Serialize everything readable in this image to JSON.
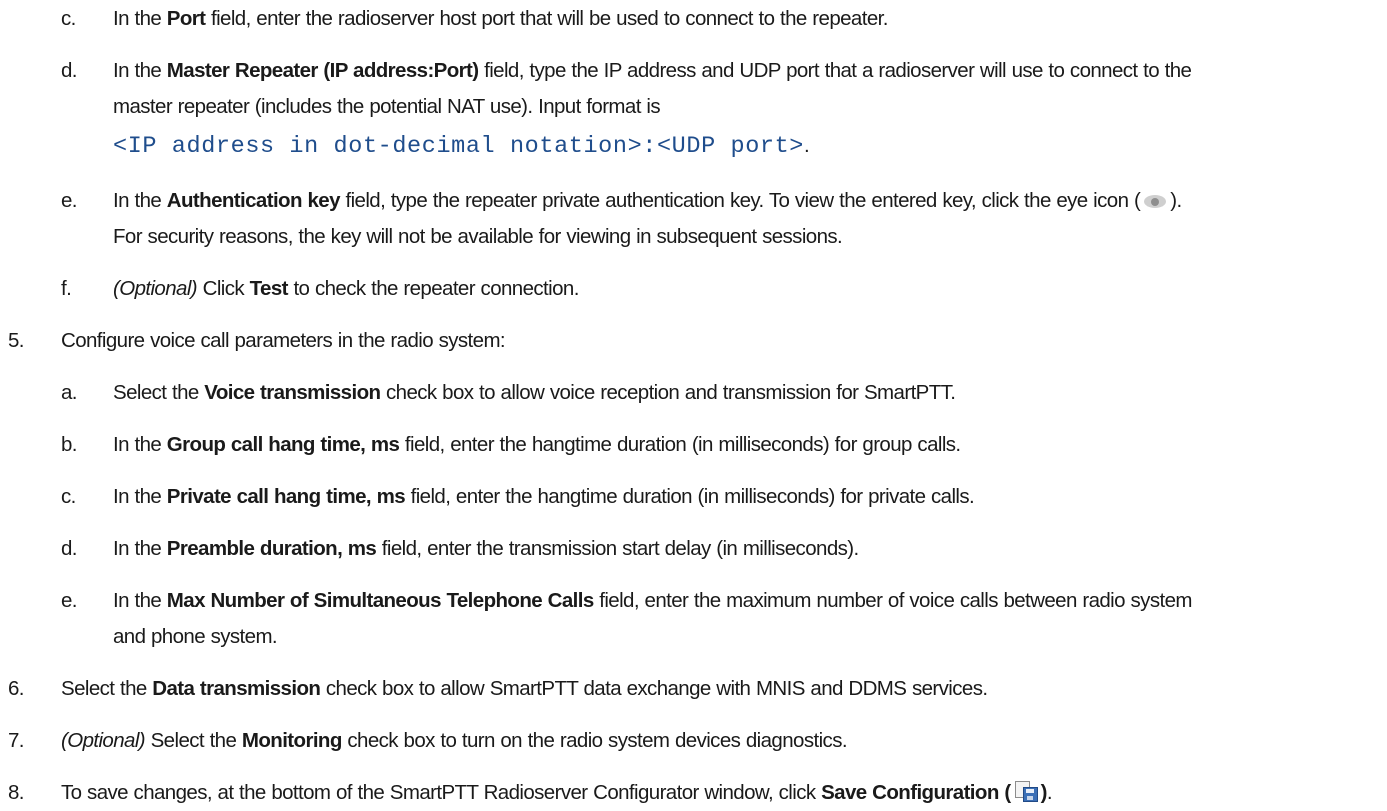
{
  "c_port": {
    "marker": "c.",
    "pre": "In the ",
    "field": "Port",
    "post": " field, enter the radioserver host port that will be used to connect to the repeater."
  },
  "d_master": {
    "marker": "d.",
    "pre": "In the ",
    "field": "Master Repeater (IP address:Port)",
    "post": " field, type the IP address and UDP port that a radioserver will use to connect to the",
    "line2": "master repeater (includes the potential NAT use). Input format is",
    "code": "<IP address in dot-decimal notation>:<UDP port>",
    "code_end": "."
  },
  "e_auth": {
    "marker": "e.",
    "pre": "In the ",
    "field": "Authentication key",
    "post": " field, type the repeater private authentication key. To view the entered key, click the eye icon (",
    "icon": "eye-icon",
    "post2": ").",
    "line2": "For security reasons, the key will not be available for viewing in subsequent sessions."
  },
  "f_test": {
    "marker": "f.",
    "optional": "(Optional)",
    "pre": " Click ",
    "button": "Test",
    "post": " to check the repeater connection."
  },
  "step5": {
    "marker": "5.",
    "text": "Configure voice call parameters in the radio system:"
  },
  "s5a": {
    "marker": "a.",
    "pre": "Select the ",
    "field": "Voice transmission",
    "post": " check box to allow voice reception and transmission for SmartPTT."
  },
  "s5b": {
    "marker": "b.",
    "pre": "In the ",
    "field": "Group call hang time, ms",
    "post": " field, enter the hangtime duration (in milliseconds) for group calls."
  },
  "s5c": {
    "marker": "c.",
    "pre": "In the ",
    "field": "Private call hang time, ms",
    "post": " field, enter the hangtime duration (in milliseconds) for private calls."
  },
  "s5d": {
    "marker": "d.",
    "pre": "In the ",
    "field": "Preamble duration, ms",
    "post": " field, enter the transmission start delay (in milliseconds)."
  },
  "s5e": {
    "marker": "e.",
    "pre": "In the ",
    "field": "Max Number of Simultaneous Telephone Calls",
    "post": " field, enter the maximum number of voice calls between radio system",
    "line2": "and phone system."
  },
  "step6": {
    "marker": "6.",
    "pre": "Select the ",
    "field": "Data transmission",
    "post": " check box to allow SmartPTT data exchange with MNIS and DDMS services."
  },
  "step7": {
    "marker": "7.",
    "optional": "(Optional)",
    "pre": " Select the ",
    "field": "Monitoring",
    "post": " check box to turn on the radio system devices diagnostics."
  },
  "step8": {
    "marker": "8.",
    "pre": "To save changes, at the bottom of the SmartPTT Radioserver Configurator window, click ",
    "button": "Save Configuration (",
    "icon": "save-icon",
    "button_end": ")",
    "post": "."
  }
}
